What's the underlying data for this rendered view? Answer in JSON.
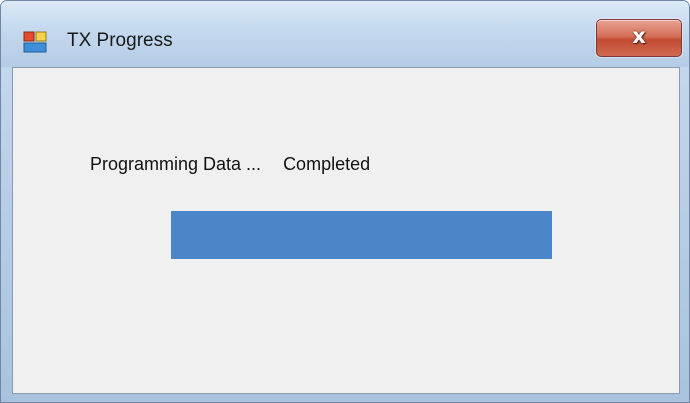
{
  "window": {
    "title": "TX Progress",
    "icon": "app-window-icon",
    "close_label": "x"
  },
  "status": {
    "label": "Programming Data ...",
    "value": "Completed"
  },
  "progress": {
    "percent": 100,
    "color": "#4a86c8"
  }
}
